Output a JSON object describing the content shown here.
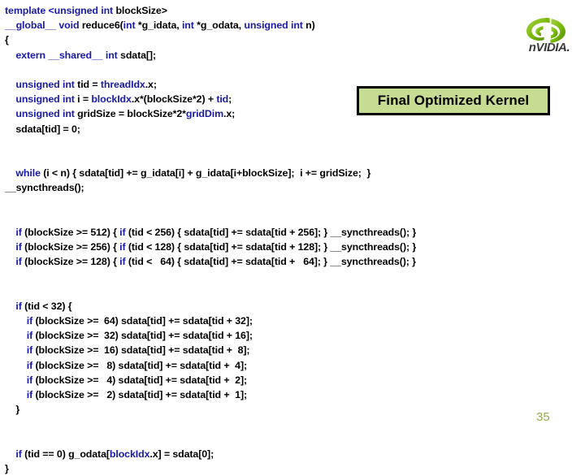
{
  "slide": {
    "page_number": "35",
    "background_color": "#ffffff",
    "keyword_color": "#1a1aa8",
    "plain_color": "#000000"
  },
  "callout": {
    "label": "Final Optimized Kernel",
    "fill_color": "#c6dc92",
    "border_color": "#000000",
    "text_color": "#000000"
  },
  "logo": {
    "name": "nvidia-logo",
    "wordmark": "nVIDIA",
    "mark_color": "#76b900",
    "wordmark_color": "#3a3a3a"
  },
  "code": {
    "language": "cuda-cpp",
    "lines": [
      {
        "id": "l01",
        "indent": 0,
        "tokens": [
          {
            "t": "template <unsigned int ",
            "k": true
          },
          {
            "t": "blockSize>",
            "k": false
          }
        ]
      },
      {
        "id": "l02",
        "indent": 0,
        "tokens": [
          {
            "t": "__global__ void ",
            "k": true
          },
          {
            "t": "reduce6(",
            "k": false
          },
          {
            "t": "int ",
            "k": true
          },
          {
            "t": "*g_idata, ",
            "k": false
          },
          {
            "t": "int ",
            "k": true
          },
          {
            "t": "*g_odata, ",
            "k": false
          },
          {
            "t": "unsigned int ",
            "k": true
          },
          {
            "t": "n)",
            "k": false
          }
        ]
      },
      {
        "id": "l03",
        "indent": 0,
        "tokens": [
          {
            "t": "{",
            "k": false
          }
        ]
      },
      {
        "id": "l04",
        "indent": 1,
        "tokens": [
          {
            "t": "extern __shared__ int ",
            "k": true
          },
          {
            "t": "sdata[];",
            "k": false
          }
        ]
      },
      {
        "id": "l05",
        "blank": true
      },
      {
        "id": "l06",
        "indent": 1,
        "tokens": [
          {
            "t": "unsigned int ",
            "k": true
          },
          {
            "t": "tid = ",
            "k": false
          },
          {
            "t": "threadIdx",
            "k": true
          },
          {
            "t": ".x;",
            "k": false
          }
        ]
      },
      {
        "id": "l07",
        "indent": 1,
        "tokens": [
          {
            "t": "unsigned int ",
            "k": true
          },
          {
            "t": "i = ",
            "k": false
          },
          {
            "t": "blockIdx",
            "k": true
          },
          {
            "t": ".x*(blockSize*2) + ",
            "k": false
          },
          {
            "t": "tid",
            "k": true
          },
          {
            "t": ";",
            "k": false
          }
        ]
      },
      {
        "id": "l08",
        "indent": 1,
        "tokens": [
          {
            "t": "unsigned int ",
            "k": true
          },
          {
            "t": "gridSize = blockSize*2*",
            "k": false
          },
          {
            "t": "gridDim",
            "k": true
          },
          {
            "t": ".x;",
            "k": false
          }
        ]
      },
      {
        "id": "l09",
        "indent": 1,
        "tokens": [
          {
            "t": "sdata[tid] = 0;",
            "k": false
          }
        ]
      },
      {
        "id": "l10",
        "blank": true
      },
      {
        "id": "l11",
        "blank": true
      },
      {
        "id": "l12",
        "indent": 1,
        "tokens": [
          {
            "t": "while ",
            "k": true
          },
          {
            "t": "(i < n) { sdata[tid] += g_idata[i] + g_idata[i+blockSize];  i += gridSize;  }",
            "k": false
          }
        ]
      },
      {
        "id": "l13",
        "indent": 0,
        "tokens": [
          {
            "t": "__syncthreads();",
            "k": false
          }
        ]
      },
      {
        "id": "l14",
        "blank": true
      },
      {
        "id": "l15",
        "blank": true
      },
      {
        "id": "l16",
        "indent": 1,
        "tokens": [
          {
            "t": "if ",
            "k": true
          },
          {
            "t": "(blockSize >= 512) { ",
            "k": false
          },
          {
            "t": "if ",
            "k": true
          },
          {
            "t": "(tid < 256) { sdata[tid] += sdata[tid + 256]; } __syncthreads(); }",
            "k": false
          }
        ]
      },
      {
        "id": "l17",
        "indent": 1,
        "tokens": [
          {
            "t": "if ",
            "k": true
          },
          {
            "t": "(blockSize >= 256) { ",
            "k": false
          },
          {
            "t": "if ",
            "k": true
          },
          {
            "t": "(tid < 128) { sdata[tid] += sdata[tid + 128]; } __syncthreads(); }",
            "k": false
          }
        ]
      },
      {
        "id": "l18",
        "indent": 1,
        "tokens": [
          {
            "t": "if ",
            "k": true
          },
          {
            "t": "(blockSize >= 128) { ",
            "k": false
          },
          {
            "t": "if ",
            "k": true
          },
          {
            "t": "(tid <   64) { sdata[tid] += sdata[tid +   64]; } __syncthreads(); }",
            "k": false
          }
        ]
      },
      {
        "id": "l19",
        "blank": true
      },
      {
        "id": "l20",
        "blank": true
      },
      {
        "id": "l21",
        "indent": 1,
        "tokens": [
          {
            "t": "if ",
            "k": true
          },
          {
            "t": "(tid < 32) {",
            "k": false
          }
        ]
      },
      {
        "id": "l22",
        "indent": 2,
        "tokens": [
          {
            "t": "if ",
            "k": true
          },
          {
            "t": "(blockSize >=  64) sdata[tid] += sdata[tid + 32];",
            "k": false
          }
        ]
      },
      {
        "id": "l23",
        "indent": 2,
        "tokens": [
          {
            "t": "if ",
            "k": true
          },
          {
            "t": "(blockSize >=  32) sdata[tid] += sdata[tid + 16];",
            "k": false
          }
        ]
      },
      {
        "id": "l24",
        "indent": 2,
        "tokens": [
          {
            "t": "if ",
            "k": true
          },
          {
            "t": "(blockSize >=  16) sdata[tid] += sdata[tid +  8];",
            "k": false
          }
        ]
      },
      {
        "id": "l25",
        "indent": 2,
        "tokens": [
          {
            "t": "if ",
            "k": true
          },
          {
            "t": "(blockSize >=   8) sdata[tid] += sdata[tid +  4];",
            "k": false
          }
        ]
      },
      {
        "id": "l26",
        "indent": 2,
        "tokens": [
          {
            "t": "if ",
            "k": true
          },
          {
            "t": "(blockSize >=   4) sdata[tid] += sdata[tid +  2];",
            "k": false
          }
        ]
      },
      {
        "id": "l27",
        "indent": 2,
        "tokens": [
          {
            "t": "if ",
            "k": true
          },
          {
            "t": "(blockSize >=   2) sdata[tid] += sdata[tid +  1];",
            "k": false
          }
        ]
      },
      {
        "id": "l28",
        "indent": 1,
        "tokens": [
          {
            "t": "}",
            "k": false
          }
        ]
      },
      {
        "id": "l29",
        "blank": true
      },
      {
        "id": "l30",
        "blank": true
      },
      {
        "id": "l31",
        "indent": 1,
        "tokens": [
          {
            "t": "if ",
            "k": true
          },
          {
            "t": "(tid == 0) g_odata[",
            "k": false
          },
          {
            "t": "blockIdx",
            "k": true
          },
          {
            "t": ".x] = sdata[0];",
            "k": false
          }
        ]
      },
      {
        "id": "l32",
        "indent": 0,
        "tokens": [
          {
            "t": "}",
            "k": false
          }
        ]
      }
    ]
  }
}
